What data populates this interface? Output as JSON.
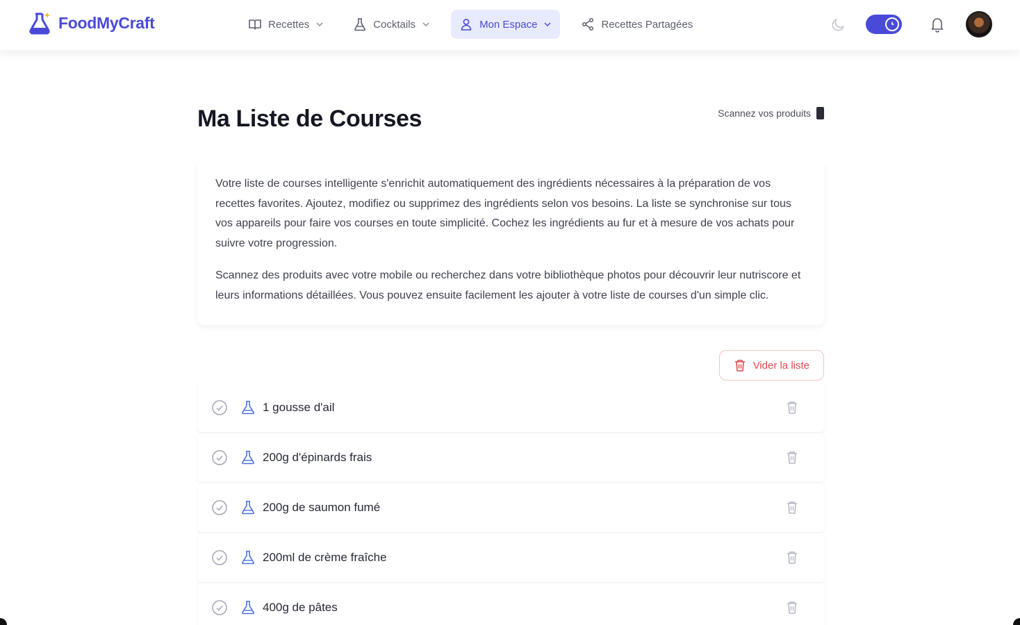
{
  "brand": {
    "name": "FoodMyCraft"
  },
  "nav": {
    "items": [
      {
        "label": "Recettes",
        "icon": "book-icon",
        "dropdown": true,
        "active": false
      },
      {
        "label": "Cocktails",
        "icon": "flask-icon",
        "dropdown": true,
        "active": false
      },
      {
        "label": "Mon Espace",
        "icon": "user-icon",
        "dropdown": true,
        "active": true
      },
      {
        "label": "Recettes Partagées",
        "icon": "share-icon",
        "dropdown": false,
        "active": false
      }
    ]
  },
  "tools": {
    "theme_icon": "moon-icon",
    "toggle_on": true,
    "notifications_icon": "bell-icon"
  },
  "page": {
    "title": "Ma Liste de Courses",
    "scan_label": "Scannez vos produits",
    "intro": [
      "Votre liste de courses intelligente s'enrichit automatiquement des ingrédients nécessaires à la préparation de vos recettes favorites. Ajoutez, modifiez ou supprimez des ingrédients selon vos besoins. La liste se synchronise sur tous vos appareils pour faire vos courses en toute simplicité. Cochez les ingrédients au fur et à mesure de vos achats pour suivre votre progression.",
      "Scannez des produits avec votre mobile ou recherchez dans votre bibliothèque photos pour découvrir leur nutriscore et leurs informations détaillées. Vous pouvez ensuite facilement les ajouter à votre liste de courses d'un simple clic."
    ],
    "clear_label": "Vider la liste"
  },
  "items": [
    {
      "label": "1 gousse d'ail"
    },
    {
      "label": "200g d'épinards frais"
    },
    {
      "label": "200g de saumon fumé"
    },
    {
      "label": "200ml de crème fraîche"
    },
    {
      "label": "400g de pâtes"
    }
  ],
  "colors": {
    "accent": "#4a4ad8",
    "accent_bg": "#e8ebff",
    "danger": "#e5484d"
  }
}
